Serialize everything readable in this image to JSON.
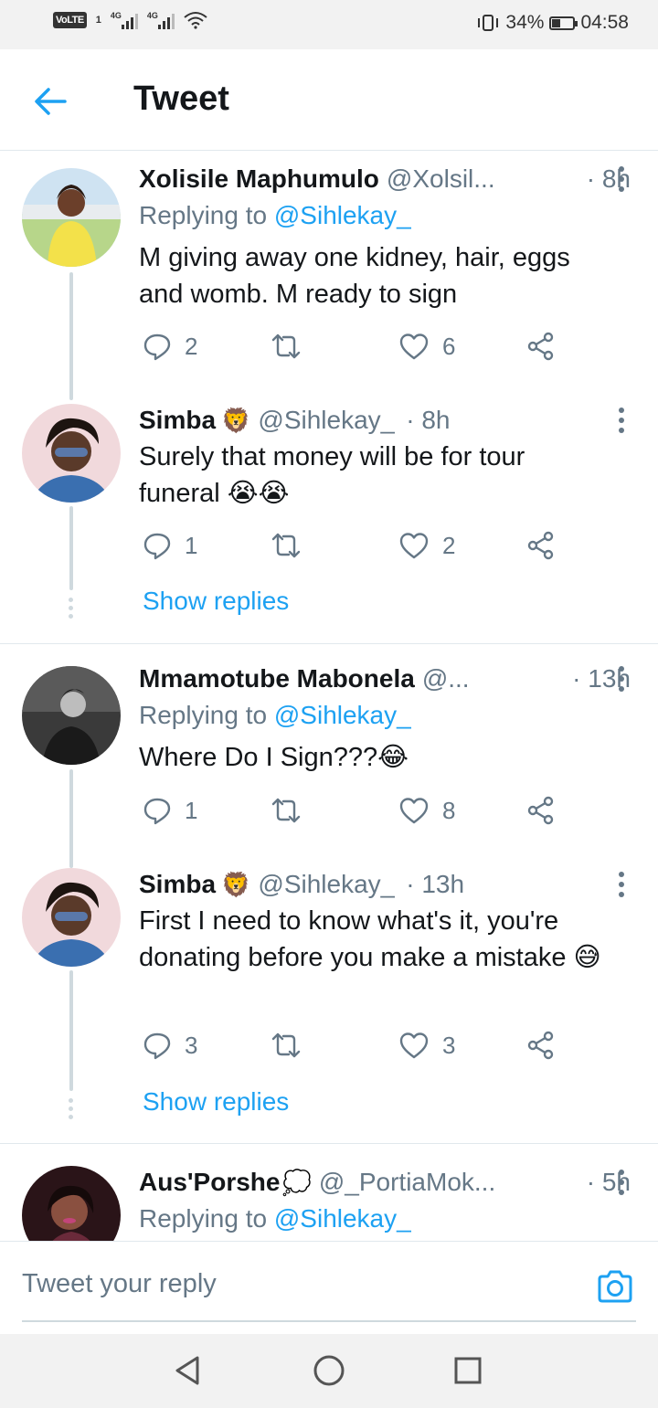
{
  "status_bar": {
    "volte": "VoLTE",
    "volte_slot": "1",
    "sim1_label": "4G",
    "sim2_label": "4G",
    "battery_percent": "34%",
    "battery_level": 0.34,
    "time": "04:58",
    "icons": [
      "signal-icon",
      "wifi-icon",
      "vibrate-icon",
      "battery-icon"
    ]
  },
  "header": {
    "title": "Tweet",
    "back_icon": "arrow-left-icon"
  },
  "tweets": [
    {
      "name": "Xolisile Maphumulo",
      "emoji": "",
      "handle": "@Xolsil...",
      "time": "· 8h",
      "replying_prefix": "Replying to",
      "replying_to": "@Sihlekay_",
      "body": "M giving away one kidney, hair, eggs and womb. M ready to sign",
      "replies": "2",
      "retweets": "",
      "likes": "6"
    },
    {
      "name": "Simba",
      "emoji": "🦁",
      "handle": "@Sihlekay_",
      "time": "· 8h",
      "body": "Surely that money will be for tour funeral 😭😭",
      "replies": "1",
      "retweets": "",
      "likes": "2",
      "show_replies": "Show replies"
    },
    {
      "name": "Mmamotube Mabonela",
      "emoji": "",
      "handle": "@...",
      "time": "· 13h",
      "replying_prefix": "Replying to",
      "replying_to": "@Sihlekay_",
      "body": "Where Do I Sign???😂",
      "replies": "1",
      "retweets": "",
      "likes": "8"
    },
    {
      "name": "Simba",
      "emoji": "🦁",
      "handle": "@Sihlekay_",
      "time": "· 13h",
      "body": "First I need to know what's it, you're donating before you make a mistake 😅",
      "replies": "3",
      "retweets": "",
      "likes": "3",
      "show_replies": "Show replies"
    },
    {
      "name": "Aus'Porshe",
      "emoji": "💭",
      "handle": "@_PortiaMok...",
      "time": "· 5h",
      "replying_prefix": "Replying to",
      "replying_to": "@Sihlekay_"
    }
  ],
  "reply_bar": {
    "placeholder": "Tweet your reply",
    "camera_icon": "camera-icon"
  },
  "colors": {
    "accent": "#1da1f2",
    "text_primary": "#14171a",
    "text_secondary": "#657786",
    "divider": "#e1e8ed"
  }
}
